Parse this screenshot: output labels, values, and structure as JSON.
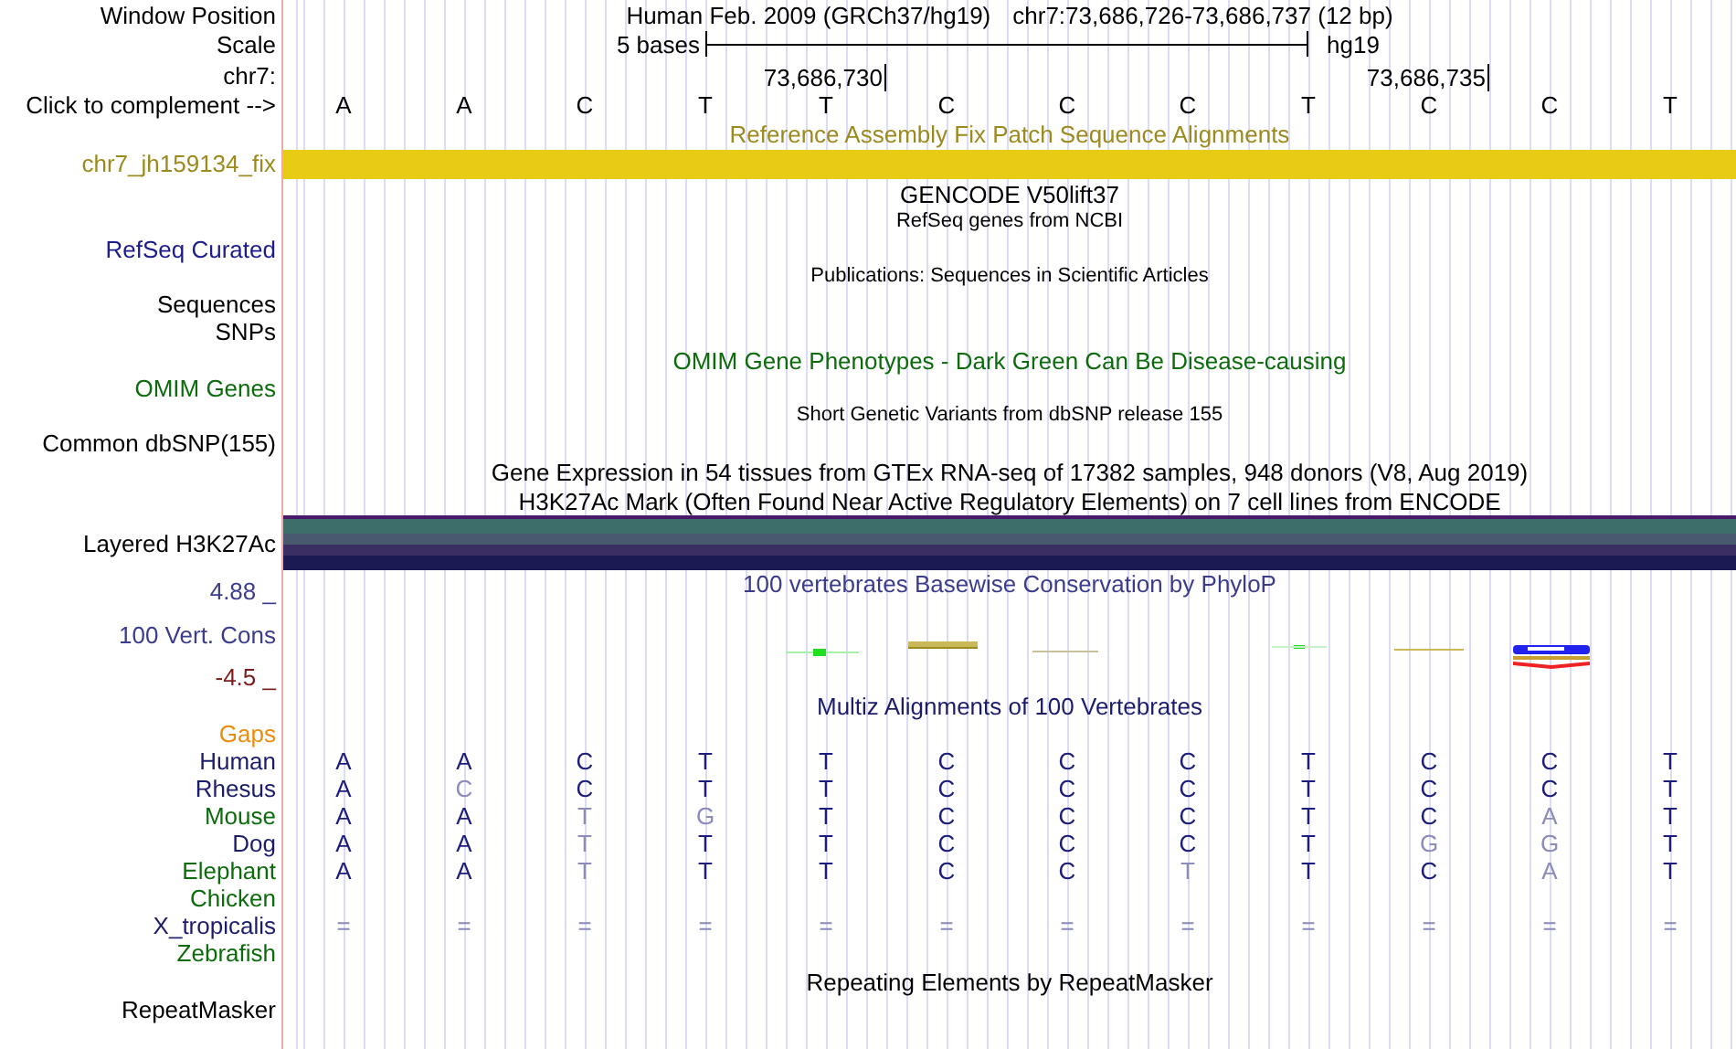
{
  "header": {
    "label": "Window Position",
    "assembly": "Human Feb. 2009 (GRCh37/hg19)",
    "position": "chr7:73,686,726-73,686,737 (12 bp)"
  },
  "scale": {
    "label": "Scale",
    "span": "5 bases",
    "assembly": "hg19"
  },
  "chrom": {
    "label": "chr7:",
    "ticks": [
      "73,686,730",
      "73,686,735"
    ]
  },
  "sequence": {
    "label": "Click to complement -->",
    "bases": [
      "A",
      "A",
      "C",
      "T",
      "T",
      "C",
      "C",
      "C",
      "T",
      "C",
      "C",
      "T"
    ]
  },
  "tracks": [
    {
      "kind": "title",
      "text": "Reference Assembly Fix Patch Sequence Alignments",
      "color": "#9c8a1e"
    },
    {
      "kind": "bar",
      "label": "chr7_jh159134_fix",
      "color": "#9c8a1e"
    },
    {
      "kind": "title",
      "text": "GENCODE V50lift37",
      "color": "#000000"
    },
    {
      "kind": "caption",
      "text": "RefSeq genes from NCBI",
      "color": "#000000"
    },
    {
      "kind": "label",
      "label": "RefSeq Curated",
      "color": "#1c1c8c"
    },
    {
      "kind": "caption",
      "text": "Publications: Sequences in Scientific Articles",
      "color": "#000000"
    },
    {
      "kind": "label",
      "label": "Sequences",
      "color": "#000000"
    },
    {
      "kind": "label",
      "label": "SNPs",
      "color": "#000000"
    },
    {
      "kind": "title",
      "text": "OMIM Gene Phenotypes - Dark Green Can Be Disease-causing",
      "color": "#0c6c0c"
    },
    {
      "kind": "label",
      "label": "OMIM Genes",
      "color": "#0c6c0c"
    },
    {
      "kind": "caption",
      "text": "Short Genetic Variants from dbSNP release 155",
      "color": "#000000"
    },
    {
      "kind": "label",
      "label": "Common dbSNP(155)",
      "color": "#000000"
    },
    {
      "kind": "title",
      "text": "Gene Expression in 54 tissues from GTEx RNA-seq of 17382 samples, 948 donors (V8, Aug 2019)",
      "color": "#000000"
    },
    {
      "kind": "title",
      "text": "H3K27Ac Mark (Often Found Near Active Regulatory Elements) on 7 cell lines from ENCODE",
      "color": "#000000"
    },
    {
      "kind": "layered",
      "label": "Layered H3K27Ac",
      "color": "#000000"
    },
    {
      "kind": "wiggle",
      "max": "4.88 _",
      "label": "100 Vert. Cons",
      "min": "-4.5 _",
      "text": "100 vertebrates Basewise Conservation by PhyloP",
      "color": "#3c3c8c"
    },
    {
      "kind": "title",
      "text": "Multiz Alignments of 100 Vertebrates",
      "color": "#1c1c6c"
    },
    {
      "kind": "label",
      "label": "Gaps",
      "color": "#ec8c0c"
    },
    {
      "kind": "species",
      "label": "Human",
      "color": "#1c1c6c",
      "bases": [
        {
          "base": "A",
          "faint": false
        },
        {
          "base": "A",
          "faint": false
        },
        {
          "base": "C",
          "faint": false
        },
        {
          "base": "T",
          "faint": false
        },
        {
          "base": "T",
          "faint": false
        },
        {
          "base": "C",
          "faint": false
        },
        {
          "base": "C",
          "faint": false
        },
        {
          "base": "C",
          "faint": false
        },
        {
          "base": "T",
          "faint": false
        },
        {
          "base": "C",
          "faint": false
        },
        {
          "base": "C",
          "faint": false
        },
        {
          "base": "T",
          "faint": false
        }
      ]
    },
    {
      "kind": "species",
      "label": "Rhesus",
      "color": "#1c1c6c",
      "bases": [
        {
          "base": "A",
          "faint": false
        },
        {
          "base": "C",
          "faint": true
        },
        {
          "base": "C",
          "faint": false
        },
        {
          "base": "T",
          "faint": false
        },
        {
          "base": "T",
          "faint": false
        },
        {
          "base": "C",
          "faint": false
        },
        {
          "base": "C",
          "faint": false
        },
        {
          "base": "C",
          "faint": false
        },
        {
          "base": "T",
          "faint": false
        },
        {
          "base": "C",
          "faint": false
        },
        {
          "base": "C",
          "faint": false
        },
        {
          "base": "T",
          "faint": false
        }
      ]
    },
    {
      "kind": "species",
      "label": "Mouse",
      "color": "#0c6c0c",
      "bases": [
        {
          "base": "A",
          "faint": false
        },
        {
          "base": "A",
          "faint": false
        },
        {
          "base": "T",
          "faint": true
        },
        {
          "base": "G",
          "faint": true
        },
        {
          "base": "T",
          "faint": false
        },
        {
          "base": "C",
          "faint": false
        },
        {
          "base": "C",
          "faint": false
        },
        {
          "base": "C",
          "faint": false
        },
        {
          "base": "T",
          "faint": false
        },
        {
          "base": "C",
          "faint": false
        },
        {
          "base": "A",
          "faint": true
        },
        {
          "base": "T",
          "faint": false
        }
      ]
    },
    {
      "kind": "species",
      "label": "Dog",
      "color": "#1c1c6c",
      "bases": [
        {
          "base": "A",
          "faint": false
        },
        {
          "base": "A",
          "faint": false
        },
        {
          "base": "T",
          "faint": true
        },
        {
          "base": "T",
          "faint": false
        },
        {
          "base": "T",
          "faint": false
        },
        {
          "base": "C",
          "faint": false
        },
        {
          "base": "C",
          "faint": false
        },
        {
          "base": "C",
          "faint": false
        },
        {
          "base": "T",
          "faint": false
        },
        {
          "base": "G",
          "faint": true
        },
        {
          "base": "G",
          "faint": true
        },
        {
          "base": "T",
          "faint": false
        }
      ]
    },
    {
      "kind": "species",
      "label": "Elephant",
      "color": "#0c6c0c",
      "bases": [
        {
          "base": "A",
          "faint": false
        },
        {
          "base": "A",
          "faint": false
        },
        {
          "base": "T",
          "faint": true
        },
        {
          "base": "T",
          "faint": false
        },
        {
          "base": "T",
          "faint": false
        },
        {
          "base": "C",
          "faint": false
        },
        {
          "base": "C",
          "faint": false
        },
        {
          "base": "T",
          "faint": true
        },
        {
          "base": "T",
          "faint": false
        },
        {
          "base": "C",
          "faint": false
        },
        {
          "base": "A",
          "faint": true
        },
        {
          "base": "T",
          "faint": false
        }
      ]
    },
    {
      "kind": "species",
      "label": "Chicken",
      "color": "#0c6c0c"
    },
    {
      "kind": "species",
      "label": "X_tropicalis",
      "color": "#1c1c6c",
      "bases": [
        {
          "base": "=",
          "faint": true
        },
        {
          "base": "=",
          "faint": true
        },
        {
          "base": "=",
          "faint": true
        },
        {
          "base": "=",
          "faint": true
        },
        {
          "base": "=",
          "faint": true
        },
        {
          "base": "=",
          "faint": true
        },
        {
          "base": "=",
          "faint": true
        },
        {
          "base": "=",
          "faint": true
        },
        {
          "base": "=",
          "faint": true
        },
        {
          "base": "=",
          "faint": true
        },
        {
          "base": "=",
          "faint": true
        },
        {
          "base": "=",
          "faint": true
        }
      ]
    },
    {
      "kind": "species",
      "label": "Zebrafish",
      "color": "#0c6c0c"
    },
    {
      "kind": "title",
      "text": "Repeating Elements by RepeatMasker",
      "color": "#000000"
    },
    {
      "kind": "label",
      "label": "RepeatMasker",
      "color": "#000000"
    }
  ]
}
